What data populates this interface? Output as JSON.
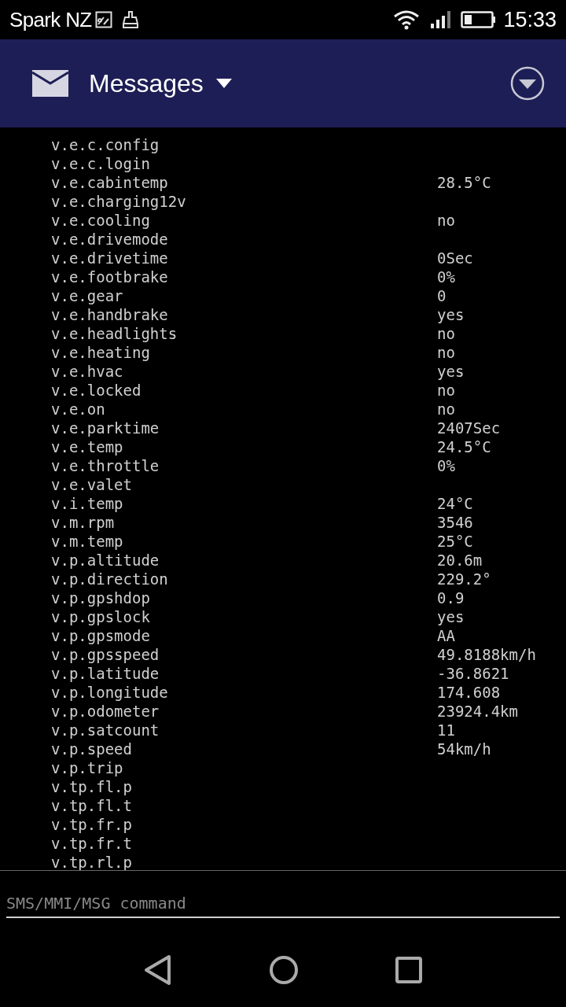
{
  "status_bar": {
    "carrier": "Spark NZ",
    "time": "15:33"
  },
  "app_bar": {
    "title": "Messages"
  },
  "metrics": [
    {
      "name": "v.e.c.config"
    },
    {
      "name": "v.e.c.login"
    },
    {
      "name": "v.e.cabintemp",
      "value": "28.5°C"
    },
    {
      "name": "v.e.charging12v"
    },
    {
      "name": "v.e.cooling",
      "value": "no"
    },
    {
      "name": "v.e.drivemode"
    },
    {
      "name": "v.e.drivetime",
      "value": "0Sec"
    },
    {
      "name": "v.e.footbrake",
      "value": "0%"
    },
    {
      "name": "v.e.gear",
      "value": "0"
    },
    {
      "name": "v.e.handbrake",
      "value": "yes"
    },
    {
      "name": "v.e.headlights",
      "value": "no"
    },
    {
      "name": "v.e.heating",
      "value": "no"
    },
    {
      "name": "v.e.hvac",
      "value": "yes"
    },
    {
      "name": "v.e.locked",
      "value": "no"
    },
    {
      "name": "v.e.on",
      "value": "no"
    },
    {
      "name": "v.e.parktime",
      "value": "2407Sec"
    },
    {
      "name": "v.e.temp",
      "value": "24.5°C"
    },
    {
      "name": "v.e.throttle",
      "value": "0%"
    },
    {
      "name": "v.e.valet"
    },
    {
      "name": "v.i.temp",
      "value": "24°C"
    },
    {
      "name": "v.m.rpm",
      "value": "3546"
    },
    {
      "name": "v.m.temp",
      "value": "25°C"
    },
    {
      "name": "v.p.altitude",
      "value": "20.6m"
    },
    {
      "name": "v.p.direction",
      "value": "229.2°"
    },
    {
      "name": "v.p.gpshdop",
      "value": "0.9"
    },
    {
      "name": "v.p.gpslock",
      "value": "yes"
    },
    {
      "name": "v.p.gpsmode",
      "value": "AA"
    },
    {
      "name": "v.p.gpsspeed",
      "value": "49.8188km/h"
    },
    {
      "name": "v.p.latitude",
      "value": "-36.8621"
    },
    {
      "name": "v.p.longitude",
      "value": "174.608"
    },
    {
      "name": "v.p.odometer",
      "value": "23924.4km"
    },
    {
      "name": "v.p.satcount",
      "value": "11"
    },
    {
      "name": "v.p.speed",
      "value": "54km/h"
    },
    {
      "name": "v.p.trip"
    },
    {
      "name": "v.tp.fl.p"
    },
    {
      "name": "v.tp.fl.t"
    },
    {
      "name": "v.tp.fr.p"
    },
    {
      "name": "v.tp.fr.t"
    },
    {
      "name": "v.tp.rl.p"
    }
  ],
  "command_field": {
    "placeholder": "SMS/MMI/MSG command"
  }
}
